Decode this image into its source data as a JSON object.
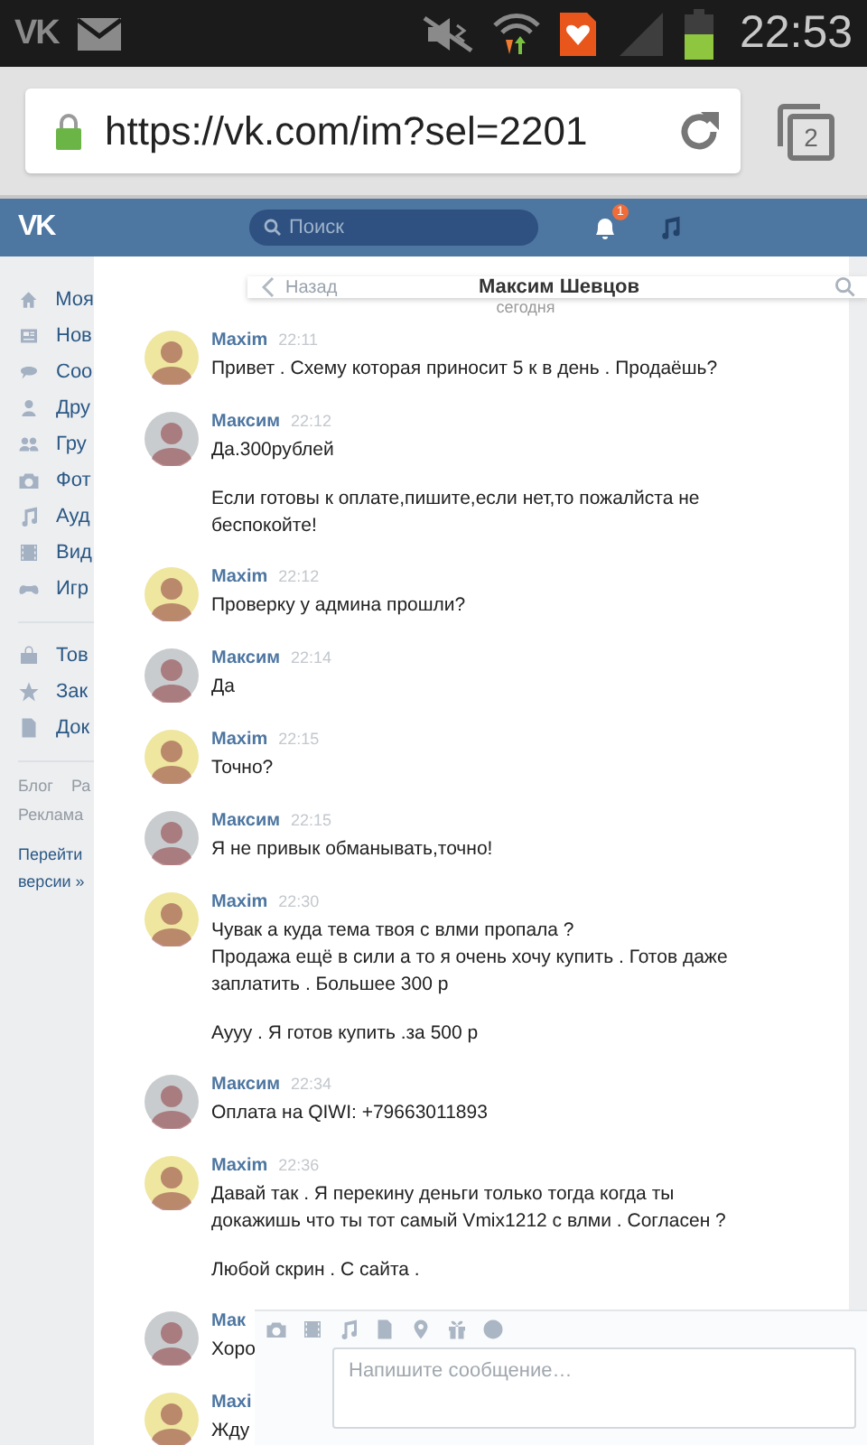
{
  "status_bar": {
    "app_logo": "VK",
    "time": "22:53"
  },
  "browser": {
    "url": "https://vk.com/im?sel=2201",
    "tab_count": "2"
  },
  "header": {
    "logo": "VK",
    "search": {
      "placeholder": "Поиск"
    },
    "notification_badge": "1"
  },
  "sidebar": {
    "groups": [
      [
        {
          "label": "Моя"
        },
        {
          "label": "Нов"
        },
        {
          "label": "Соо"
        },
        {
          "label": "Дру"
        },
        {
          "label": "Гру"
        },
        {
          "label": "Фот"
        },
        {
          "label": "Ауд"
        },
        {
          "label": "Вид"
        },
        {
          "label": "Игр"
        }
      ],
      [
        {
          "label": "Тов"
        },
        {
          "label": "Зак"
        },
        {
          "label": "Док"
        }
      ]
    ],
    "footer_rows": [
      [
        "Блог",
        "Ра"
      ],
      [
        "Реклама"
      ]
    ],
    "full_version_link": "Перейти\nверсии »"
  },
  "chat": {
    "back": "Назад",
    "title": "Максим Шевцов",
    "date": "сегодня",
    "messages": [
      {
        "sender": "Maxim",
        "time": "22:11",
        "color": "#efe6a0",
        "paragraphs": [
          "Привет . Схему которая приносит 5 к в день . Продаёшь?"
        ]
      },
      {
        "sender": "Максим",
        "time": "22:12",
        "color": "#c9ccce",
        "paragraphs": [
          "Да.300рублей",
          "Если готовы к оплате,пишите,если нет,то пожалйста не беспокойте!"
        ]
      },
      {
        "sender": "Maxim",
        "time": "22:12",
        "color": "#efe6a0",
        "paragraphs": [
          "Проверку у админа прошли?"
        ]
      },
      {
        "sender": "Максим",
        "time": "22:14",
        "color": "#c9ccce",
        "paragraphs": [
          "Да"
        ]
      },
      {
        "sender": "Maxim",
        "time": "22:15",
        "color": "#efe6a0",
        "paragraphs": [
          "Точно?"
        ]
      },
      {
        "sender": "Максим",
        "time": "22:15",
        "color": "#c9ccce",
        "paragraphs": [
          "Я не привык обманывать,точно!"
        ]
      },
      {
        "sender": "Maxim",
        "time": "22:30",
        "color": "#efe6a0",
        "paragraphs": [
          "Чувак а куда тема твоя с влми пропала ?\nПродажа ещё в сили а то я очень хочу купить . Готов даже заплатить . Большее 300 р",
          "Аууу . Я готов купить .за 500 р"
        ]
      },
      {
        "sender": "Максим",
        "time": "22:34",
        "color": "#c9ccce",
        "paragraphs": [
          "Оплата на QIWI: +79663011893"
        ]
      },
      {
        "sender": "Maxim",
        "time": "22:36",
        "color": "#efe6a0",
        "paragraphs": [
          "Давай так . Я перекину деньги только тогда когда ты докажишь что ты тот самый Vmix1212 с влми . Согласен ?",
          "Любой скрин . С сайта ."
        ]
      },
      {
        "sender": "Мак",
        "color": "#c9ccce",
        "paragraphs": [
          "Хоро"
        ]
      },
      {
        "sender": "Maxi",
        "color": "#efe6a0",
        "paragraphs": [
          "Жду"
        ]
      }
    ]
  },
  "composer": {
    "placeholder": "Напишите сообщение…"
  }
}
